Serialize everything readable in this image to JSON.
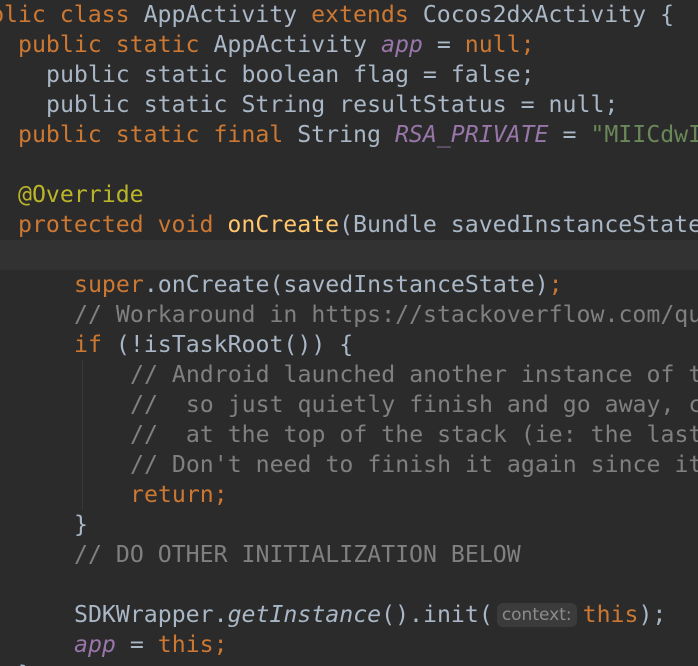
{
  "editor": {
    "colors": {
      "background": "#2b2b2b",
      "current_line": "#323232",
      "keyword": "#cc7832",
      "identifier": "#a9b7c6",
      "field": "#9876aa",
      "string": "#6a8759",
      "comment": "#808080",
      "annotation": "#bbb529",
      "method": "#ffc66d"
    },
    "lines": {
      "l0": {
        "a": "blic class ",
        "b": "AppActivity ",
        "c": "extends ",
        "d": "Cocos2dxActivity {"
      },
      "l1": {
        "a": "public static ",
        "b": "AppActivity ",
        "c": "app",
        "d": " = ",
        "e": "null",
        "f": ";"
      },
      "l2": {
        "a": "public static boolean flag = false;"
      },
      "l3": {
        "a": "public static String resultStatus = null;"
      },
      "l4": {
        "a": "public static final ",
        "b": "String ",
        "c": "RSA_PRIVATE",
        "d": " = ",
        "e": "\"MIICdwI"
      },
      "l6": {
        "a": "@Override"
      },
      "l7": {
        "a": "protected void ",
        "b": "onCreate",
        "c": "(Bundle savedInstanceState"
      },
      "l9": {
        "a": "super",
        "b": ".onCreate(savedInstanceState)",
        "c": ";"
      },
      "l10": {
        "a": "// Workaround in https://stackoverflow.com/qu"
      },
      "l11": {
        "a": "if ",
        "b": "(!isTaskRoot()) {"
      },
      "l12": {
        "a": "// Android launched another instance of t"
      },
      "l13": {
        "a": "//  so just quietly finish and go away, c"
      },
      "l14": {
        "a": "//  at the top of the stack (ie: the last"
      },
      "l15": {
        "a": "// Don't need to finish it again since it"
      },
      "l16": {
        "a": "return;"
      },
      "l17": {
        "a": "}"
      },
      "l18": {
        "a": "// DO OTHER INITIALIZATION BELOW"
      },
      "l20": {
        "a": "SDKWrapper.",
        "b": "getInstance",
        "c": "().init(",
        "hint": "context:",
        "d": "this",
        "e": ");"
      },
      "l21": {
        "a": "app",
        "b": " = ",
        "c": "this",
        "d": ";"
      },
      "l22": {
        "a": "}"
      }
    }
  }
}
